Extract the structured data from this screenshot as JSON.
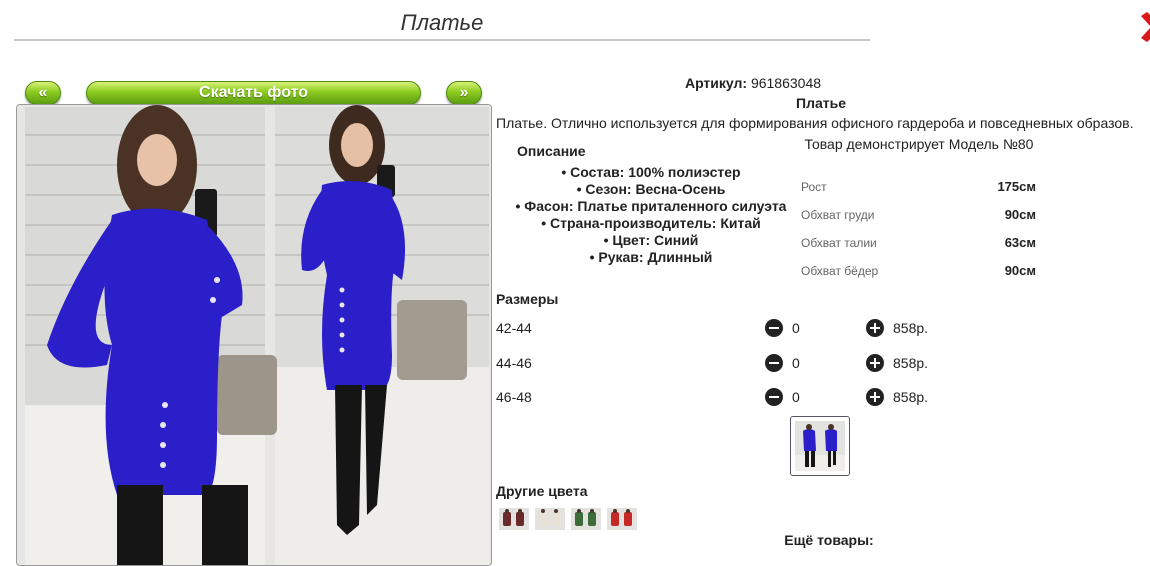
{
  "header": {
    "title": "Платье"
  },
  "gallery": {
    "prev_label": "«",
    "download_label": "Скачать фото",
    "next_label": "»"
  },
  "product": {
    "sku_label": "Артикул:",
    "sku_value": "961863048",
    "name": "Платье",
    "intro": "Платье. Отлично используется для формирования офисного гардероба и повседневных образов."
  },
  "description": {
    "title": "Описание",
    "items": [
      "• Состав: 100% полиэстер",
      "• Сезон: Весна-Осень",
      "• Фасон: Платье приталенного силуэта",
      "• Страна-производитель: Китай",
      "• Цвет: Синий",
      "• Рукав: Длинный"
    ]
  },
  "model": {
    "title": "Товар демонстрирует Модель №80",
    "rows": [
      {
        "label": "Рост",
        "value": "175см"
      },
      {
        "label": "Обхват груди",
        "value": "90см"
      },
      {
        "label": "Обхват талии",
        "value": "63см"
      },
      {
        "label": "Обхват бёдер",
        "value": "90см"
      }
    ]
  },
  "sizes": {
    "title": "Размеры",
    "rows": [
      {
        "size": "42-44",
        "qty": "0",
        "price": "858р."
      },
      {
        "size": "44-46",
        "qty": "0",
        "price": "858р."
      },
      {
        "size": "46-48",
        "qty": "0",
        "price": "858р."
      }
    ]
  },
  "other_colors": {
    "title": "Другие цвета",
    "swatches": [
      "#6b2a2a",
      "#e8e2d6",
      "#3e6b3a",
      "#c62828"
    ]
  },
  "more_products": {
    "title": "Ещё товары:"
  },
  "colors": {
    "accent_green": "#8ccb1f",
    "dress_blue": "#2a1fc9",
    "close_red": "#d7191c"
  }
}
